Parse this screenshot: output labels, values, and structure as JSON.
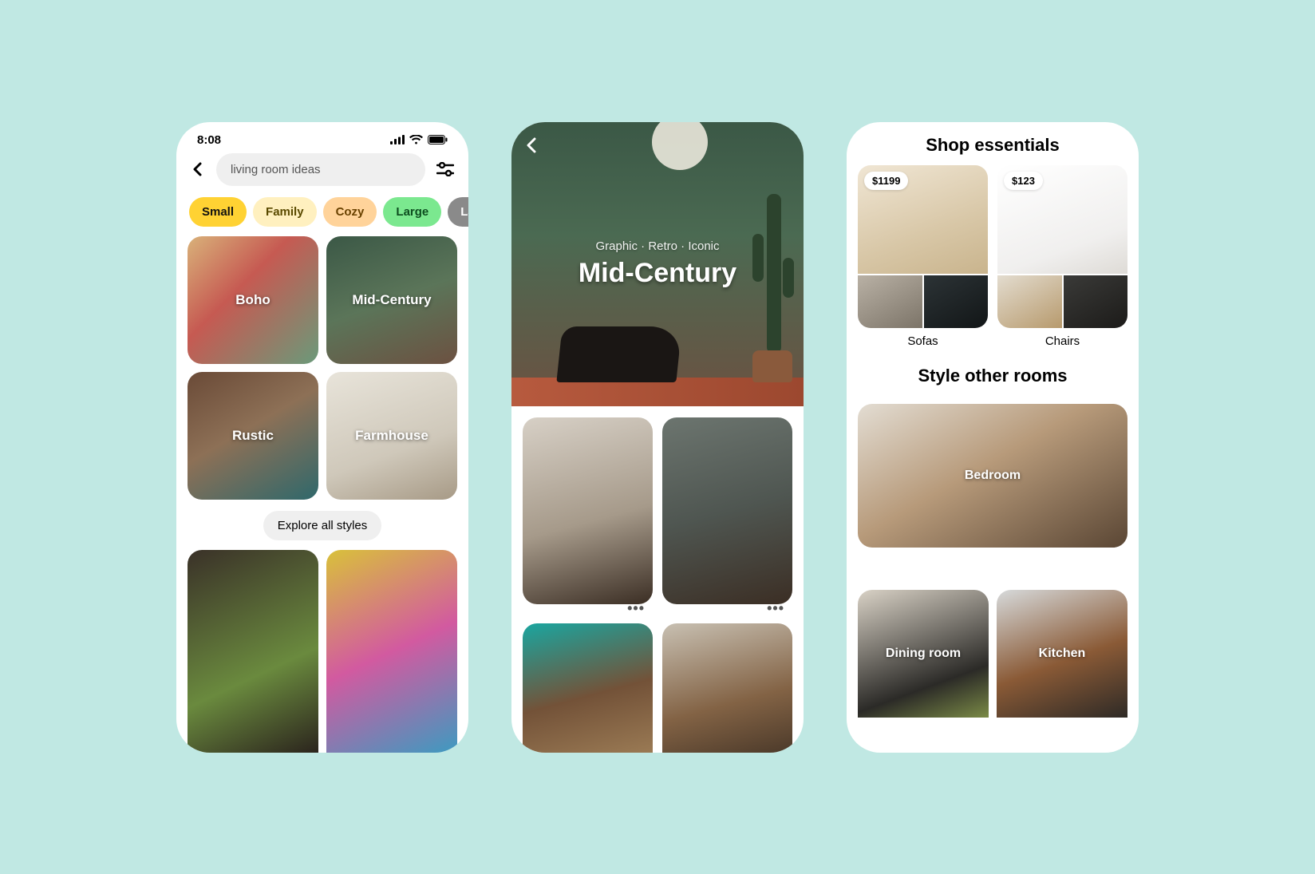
{
  "phone1": {
    "status": {
      "time": "8:08"
    },
    "search": {
      "query": "living room ideas"
    },
    "chips": [
      {
        "label": "Small",
        "bg": "#ffd233",
        "fg": "#111111"
      },
      {
        "label": "Family",
        "bg": "#fff0bf",
        "fg": "#5a4a00"
      },
      {
        "label": "Cozy",
        "bg": "#ffd39a",
        "fg": "#6a4200"
      },
      {
        "label": "Large",
        "bg": "#7be88f",
        "fg": "#0d4d1f"
      },
      {
        "label": "Layo",
        "bg": "#8a8a8a",
        "fg": "#ffffff"
      }
    ],
    "styles": [
      {
        "label": "Boho"
      },
      {
        "label": "Mid-Century"
      },
      {
        "label": "Rustic"
      },
      {
        "label": "Farmhouse"
      }
    ],
    "explore": "Explore all styles"
  },
  "phone2": {
    "subtitle": "Graphic · Retro · Iconic",
    "title": "Mid-Century",
    "more": "•••"
  },
  "phone3": {
    "shop_title": "Shop essentials",
    "items": [
      {
        "label": "Sofas",
        "price": "$1199"
      },
      {
        "label": "Chairs",
        "price": "$123"
      }
    ],
    "rooms_title": "Style other rooms",
    "rooms": [
      {
        "label": "Bedroom"
      },
      {
        "label": "Dining room"
      },
      {
        "label": "Kitchen"
      }
    ]
  }
}
